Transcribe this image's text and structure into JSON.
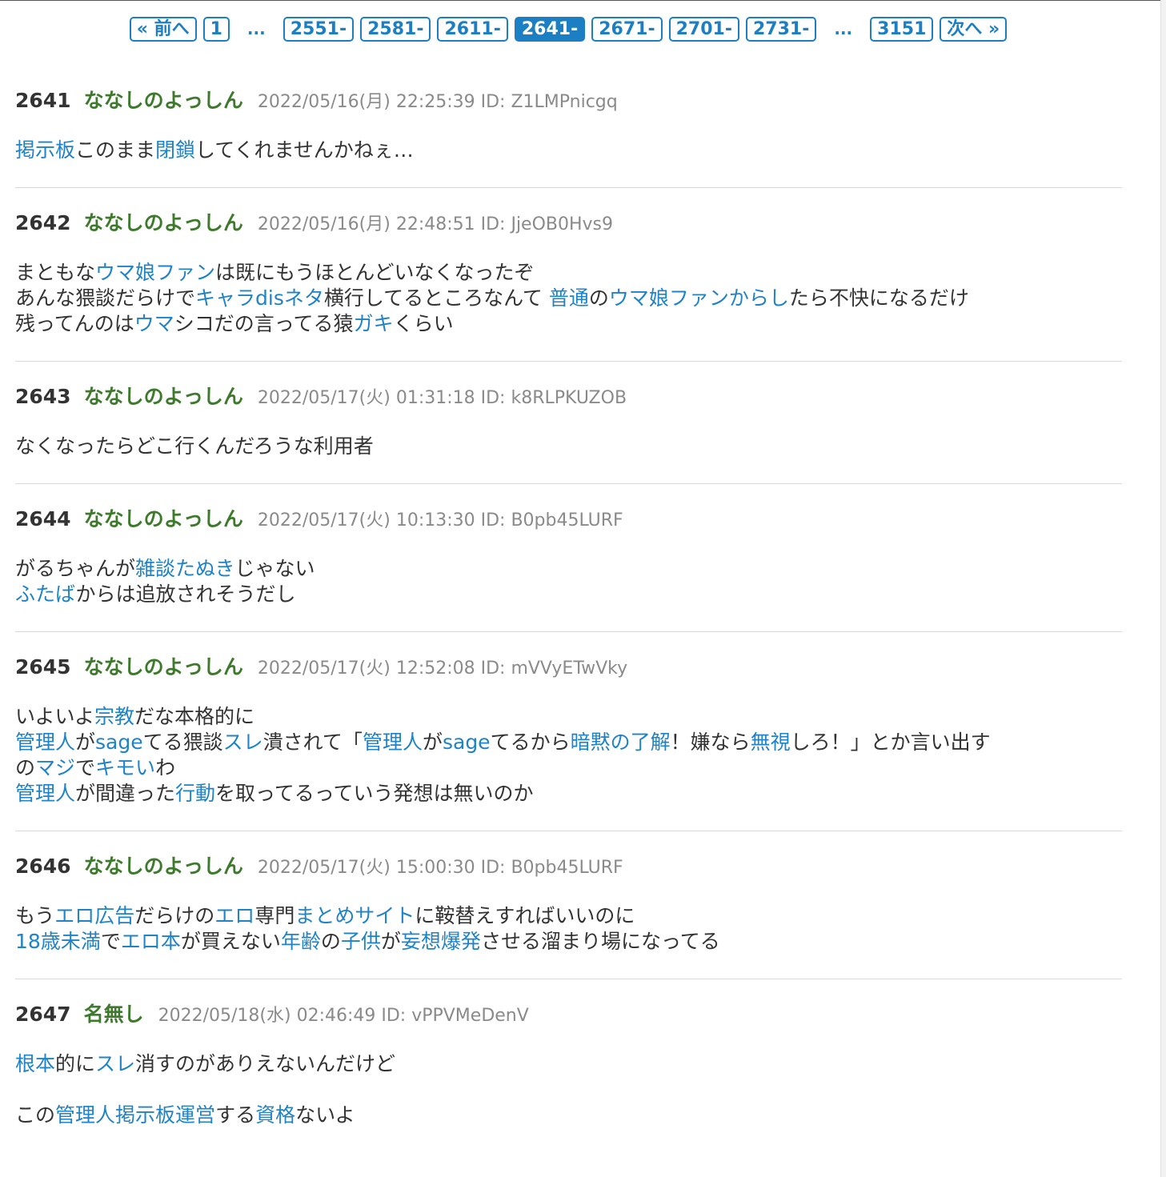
{
  "pager": {
    "items": [
      {
        "label": "« 前へ",
        "type": "prev",
        "current": false
      },
      {
        "label": "1",
        "type": "page",
        "current": false
      },
      {
        "label": "...",
        "type": "ellipsis",
        "current": false
      },
      {
        "label": "2551-",
        "type": "page",
        "current": false
      },
      {
        "label": "2581-",
        "type": "page",
        "current": false
      },
      {
        "label": "2611-",
        "type": "page",
        "current": false
      },
      {
        "label": "2641-",
        "type": "page",
        "current": true
      },
      {
        "label": "2671-",
        "type": "page",
        "current": false
      },
      {
        "label": "2701-",
        "type": "page",
        "current": false
      },
      {
        "label": "2731-",
        "type": "page",
        "current": false
      },
      {
        "label": "...",
        "type": "ellipsis",
        "current": false
      },
      {
        "label": "3151",
        "type": "page",
        "current": false
      },
      {
        "label": "次へ »",
        "type": "next",
        "current": false
      }
    ]
  },
  "colors": {
    "link": "#1e83c8",
    "pager_blue": "#1c7fc4",
    "name_green": "#3d7a2c",
    "meta_gray": "#8a8a8a",
    "text": "#333333"
  },
  "posts": [
    {
      "number": "2641",
      "name": "ななしのよっしん",
      "meta": "2022/05/16(月) 22:25:39 ID: Z1LMPnicgq",
      "lines": [
        [
          {
            "t": "掲示板",
            "k": true
          },
          {
            "t": "このまま"
          },
          {
            "t": "閉鎖",
            "k": true
          },
          {
            "t": "してくれませんかねぇ…"
          }
        ]
      ]
    },
    {
      "number": "2642",
      "name": "ななしのよっしん",
      "meta": "2022/05/16(月) 22:48:51 ID: JjeOB0Hvs9",
      "lines": [
        [
          {
            "t": "まともな"
          },
          {
            "t": "ウマ娘ファン",
            "k": true
          },
          {
            "t": "は既にもうほとんどいなくなったぞ"
          }
        ],
        [
          {
            "t": "あんな猥談だらけで"
          },
          {
            "t": "キャラdisネタ",
            "k": true
          },
          {
            "t": "横行してるところなんて "
          },
          {
            "t": "普通",
            "k": true
          },
          {
            "t": "の"
          },
          {
            "t": "ウマ娘ファンからし",
            "k": true
          },
          {
            "t": "たら不快になるだけ"
          }
        ],
        [
          {
            "t": "残ってんのは"
          },
          {
            "t": "ウマ",
            "k": true
          },
          {
            "t": "シコだの言ってる猿"
          },
          {
            "t": "ガキ",
            "k": true
          },
          {
            "t": "くらい"
          }
        ]
      ]
    },
    {
      "number": "2643",
      "name": "ななしのよっしん",
      "meta": "2022/05/17(火) 01:31:18 ID: k8RLPKUZOB",
      "lines": [
        [
          {
            "t": "なくなったらどこ行くんだろうな利用者"
          }
        ]
      ]
    },
    {
      "number": "2644",
      "name": "ななしのよっしん",
      "meta": "2022/05/17(火) 10:13:30 ID: B0pb45LURF",
      "lines": [
        [
          {
            "t": "がるちゃんが"
          },
          {
            "t": "雑談たぬき",
            "k": true
          },
          {
            "t": "じゃない"
          }
        ],
        [
          {
            "t": "ふたば",
            "k": true
          },
          {
            "t": "からは追放されそうだし"
          }
        ]
      ]
    },
    {
      "number": "2645",
      "name": "ななしのよっしん",
      "meta": "2022/05/17(火) 12:52:08 ID: mVVyETwVky",
      "lines": [
        [
          {
            "t": "いよいよ"
          },
          {
            "t": "宗教",
            "k": true
          },
          {
            "t": "だな本格的に"
          }
        ],
        [
          {
            "t": "管理人",
            "k": true
          },
          {
            "t": "が"
          },
          {
            "t": "sage",
            "k": true
          },
          {
            "t": "てる猥談"
          },
          {
            "t": "スレ",
            "k": true
          },
          {
            "t": "潰されて「"
          },
          {
            "t": "管理人",
            "k": true
          },
          {
            "t": "が"
          },
          {
            "t": "sage",
            "k": true
          },
          {
            "t": "てるから"
          },
          {
            "t": "暗黙の了解",
            "k": true
          },
          {
            "t": "！嫌なら"
          },
          {
            "t": "無視",
            "k": true
          },
          {
            "t": "しろ！」とか言い出す"
          }
        ],
        [
          {
            "t": "の"
          },
          {
            "t": "マジ",
            "k": true
          },
          {
            "t": "で"
          },
          {
            "t": "キモい",
            "k": true
          },
          {
            "t": "わ"
          }
        ],
        [
          {
            "t": "管理人",
            "k": true
          },
          {
            "t": "が間違った"
          },
          {
            "t": "行動",
            "k": true
          },
          {
            "t": "を取ってるっていう発想は無いのか"
          }
        ]
      ]
    },
    {
      "number": "2646",
      "name": "ななしのよっしん",
      "meta": "2022/05/17(火) 15:00:30 ID: B0pb45LURF",
      "lines": [
        [
          {
            "t": "もう"
          },
          {
            "t": "エロ広告",
            "k": true
          },
          {
            "t": "だらけの"
          },
          {
            "t": "エロ",
            "k": true
          },
          {
            "t": "専門"
          },
          {
            "t": "まとめサイト",
            "k": true
          },
          {
            "t": "に鞍替えすればいいのに"
          }
        ],
        [
          {
            "t": "18歳未満",
            "k": true
          },
          {
            "t": "で"
          },
          {
            "t": "エロ本",
            "k": true
          },
          {
            "t": "が買えない"
          },
          {
            "t": "年齢",
            "k": true
          },
          {
            "t": "の"
          },
          {
            "t": "子供",
            "k": true
          },
          {
            "t": "が"
          },
          {
            "t": "妄想爆発",
            "k": true
          },
          {
            "t": "させる溜まり場になってる"
          }
        ]
      ]
    },
    {
      "number": "2647",
      "name": "名無し",
      "meta": "2022/05/18(水) 02:46:49 ID: vPPVMeDenV",
      "lines": [
        [
          {
            "t": "根本",
            "k": true
          },
          {
            "t": "的に"
          },
          {
            "t": "スレ",
            "k": true
          },
          {
            "t": "消すのがありえないんだけど"
          }
        ],
        [],
        [
          {
            "t": "この"
          },
          {
            "t": "管理人",
            "k": true
          },
          {
            "t": "掲示板",
            "k": true
          },
          {
            "t": "運営",
            "k": true
          },
          {
            "t": "する"
          },
          {
            "t": "資格",
            "k": true
          },
          {
            "t": "ないよ"
          }
        ]
      ]
    }
  ]
}
